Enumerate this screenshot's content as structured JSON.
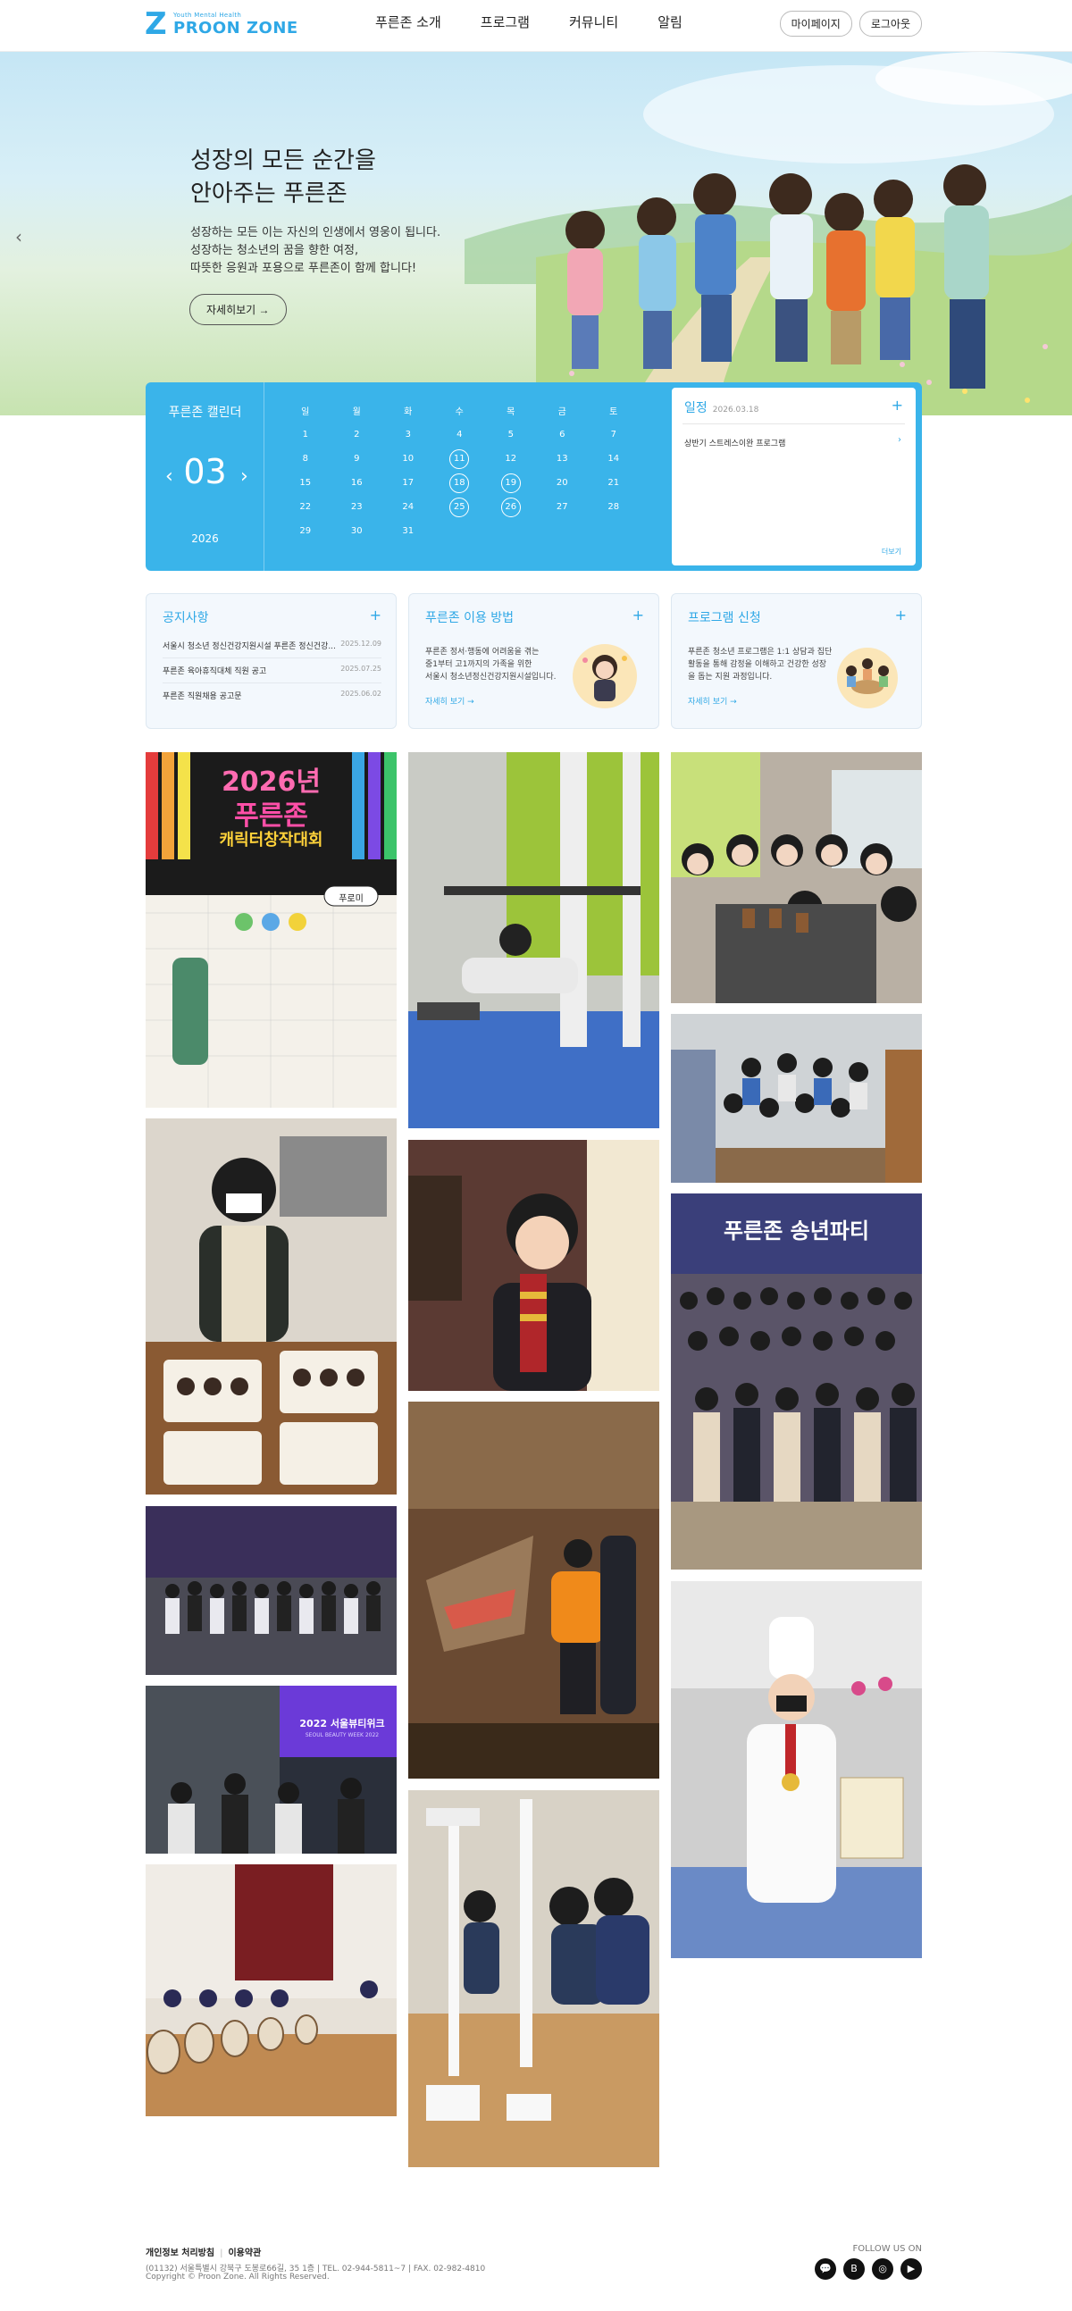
{
  "header": {
    "logo_sub": "Youth Mental Health",
    "logo_main": "PROON ZONE",
    "nav": [
      "푸른존 소개",
      "프로그램",
      "커뮤니티",
      "알림"
    ],
    "buttons": [
      "마이페이지",
      "로그아웃"
    ]
  },
  "hero": {
    "title": "성장의 모든 순간을\n안아주는 푸른존",
    "description": "성장하는 모든 이는 자신의 인생에서 영웅이 됩니다.\n성장하는 청소년의 꿈을 향한 여정,\n따뜻한 응원과 포용으로 푸른존이 함께 합니다!",
    "button": "자세히보기 →",
    "prev_arrow": "‹"
  },
  "calendar": {
    "title": "푸른존 캘린더",
    "month": "03",
    "year": "2026",
    "prev": "‹",
    "next": "›",
    "weekdays": [
      "일",
      "월",
      "화",
      "수",
      "목",
      "금",
      "토"
    ],
    "weeks": [
      [
        "1",
        "2",
        "3",
        "4",
        "5",
        "6",
        "7"
      ],
      [
        "8",
        "9",
        "10",
        "11",
        "12",
        "13",
        "14"
      ],
      [
        "15",
        "16",
        "17",
        "18",
        "19",
        "20",
        "21"
      ],
      [
        "22",
        "23",
        "24",
        "25",
        "26",
        "27",
        "28"
      ],
      [
        "29",
        "30",
        "31",
        "",
        "",
        "",
        ""
      ]
    ],
    "event_days": [
      "11",
      "18",
      "19",
      "25",
      "26"
    ]
  },
  "schedule": {
    "title": "일정",
    "date": "2026.03.18",
    "plus": "+",
    "item": "상반기 스트레스이완 프로그램",
    "item_arrow": "›",
    "more": "더보기"
  },
  "cards": {
    "notice": {
      "title": "공지사항",
      "plus": "+",
      "rows": [
        {
          "text": "서울시 청소년 정신건강지원시설 푸른존 정신건강...",
          "date": "2025.12.09"
        },
        {
          "text": "푸른존 육아휴직대체 직원 공고",
          "date": "2025.07.25"
        },
        {
          "text": "푸른존 직원채용 공고문",
          "date": "2025.06.02"
        }
      ]
    },
    "usage": {
      "title": "푸른존 이용 방법",
      "plus": "+",
      "desc": "푸른존 정서·행동에 어려움을 겪는\n중1부터 고1까지의 가족을 위한\n서울시 청소년정신건강지원시설입니다.",
      "more": "자세히 보기 →"
    },
    "apply": {
      "title": "프로그램 신청",
      "plus": "+",
      "desc": "푸른존 청소년 프로그램은 1:1 상담과  집단\n활동을 통해 감정을 이해하고  건강한 성장\n을 돕는 지원 과정입니다.",
      "more": "자세히 보기 →"
    }
  },
  "gallery": {
    "poster_title1": "2026년",
    "poster_title2": "푸른존",
    "poster_title3": "캐릭터창작대회",
    "banner_party": "푸른존 송년파티",
    "banner_beauty": "2022 서울뷰티위크",
    "banner_beauty_sub": "SEOUL BEAUTY WEEK 2022",
    "bubble": "푸로미"
  },
  "footer": {
    "privacy": "개인정보 처리방침",
    "terms": "이용약관",
    "address": "(01132) 서울특별시 강북구 도봉로66길, 35 1층  |  TEL. 02-944-5811~7  |  FAX. 02-982-4810",
    "copyright": "Copyright © Proon Zone. All Rights Reserved.",
    "follow": "FOLLOW US ON",
    "icons": [
      "💬",
      "B",
      "◎",
      "▶"
    ]
  },
  "colors": {
    "accent": "#3ab4ea",
    "text": "#222222",
    "card_bg": "#f3f8fd"
  }
}
